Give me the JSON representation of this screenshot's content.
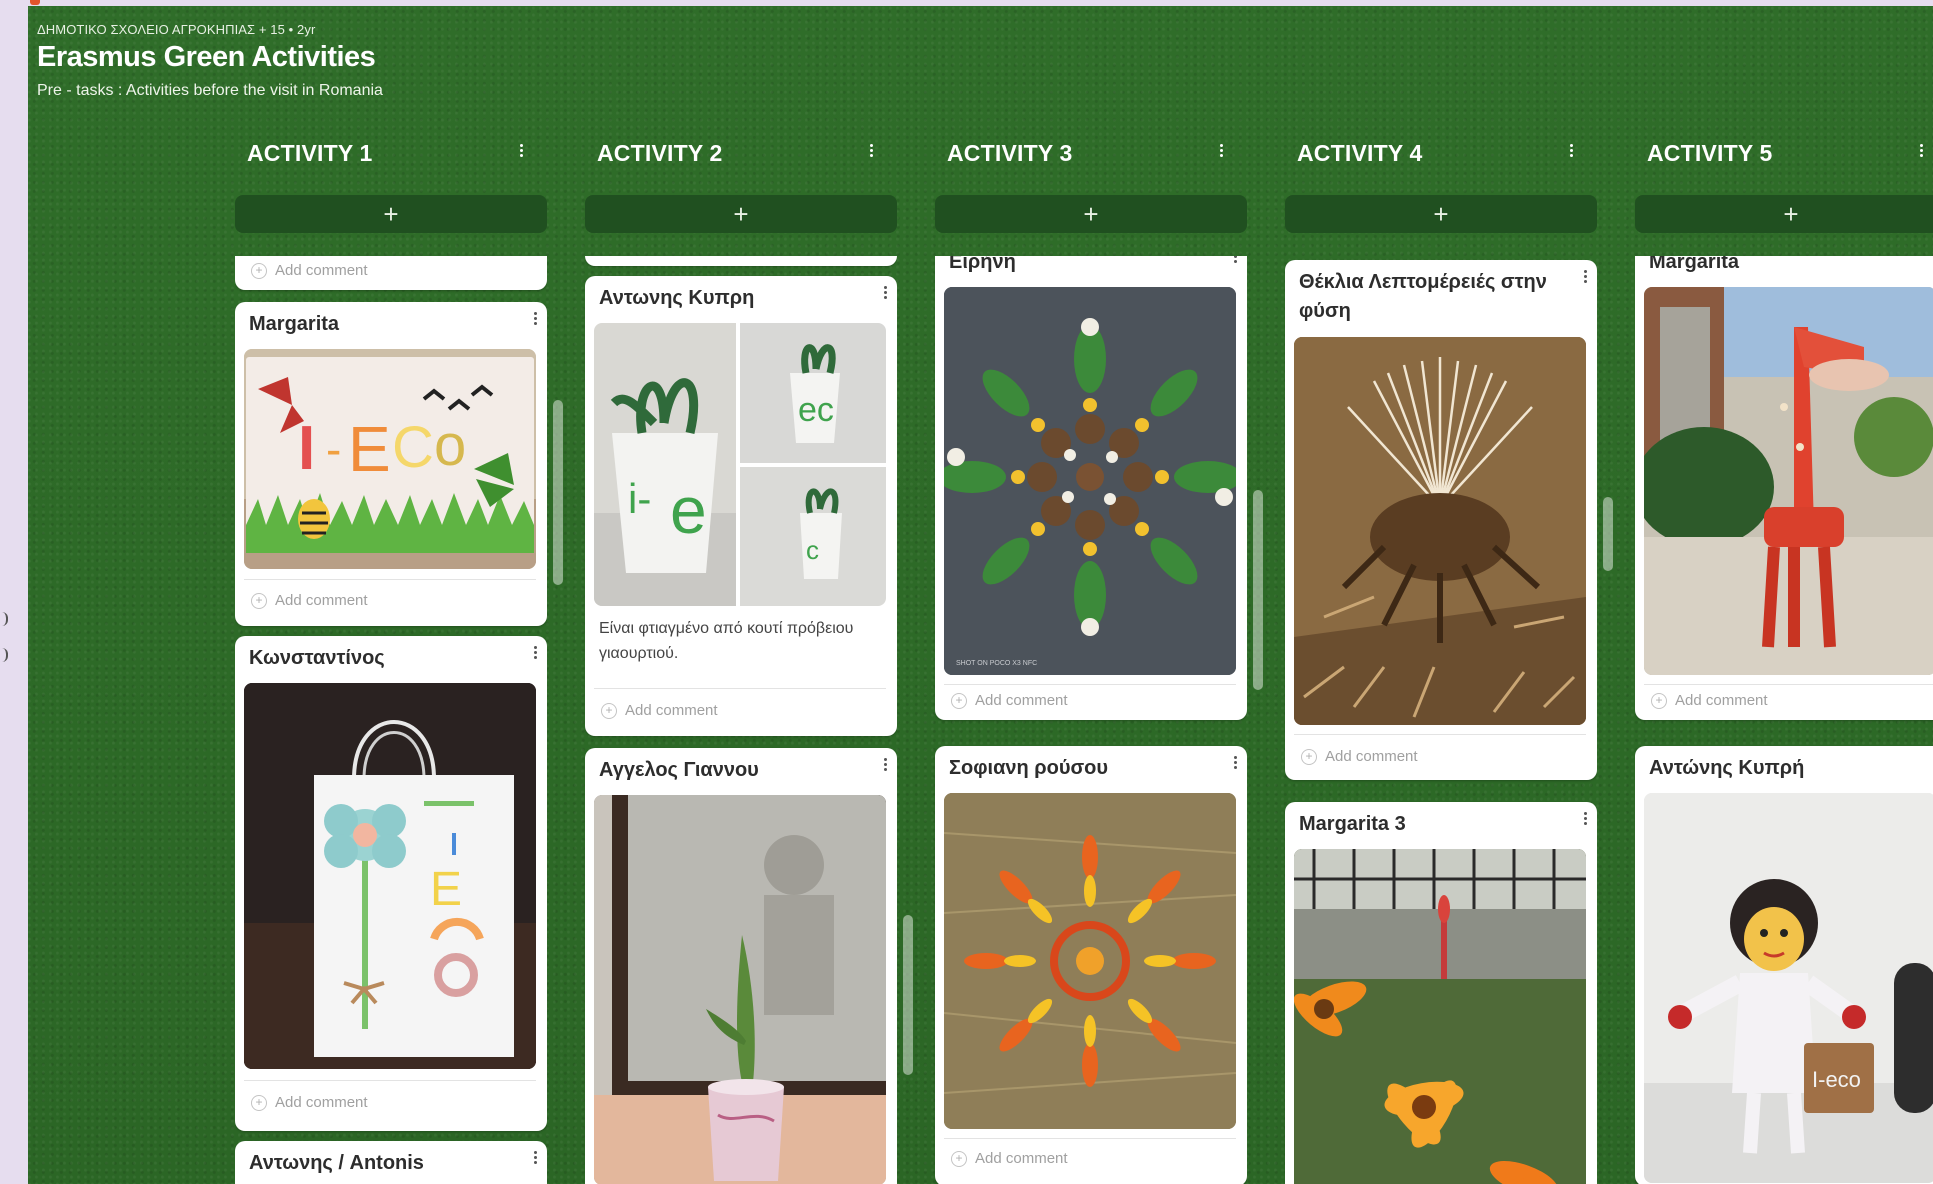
{
  "board": {
    "breadcrumb": "ΔΗΜΟΤΙΚΟ ΣΧΟΛΕΙΟ ΑΓΡΟΚΗΠΙΑΣ + 15 • 2yr",
    "title": "Erasmus Green Activities",
    "subtitle": "Pre - tasks : Activities before the visit in Romania"
  },
  "add_symbol": "+",
  "add_comment_label": "Add comment",
  "columns": [
    {
      "title": "ACTIVITY 1",
      "cards": [
        {
          "title": "Margarita",
          "image": "i-eco-paper-bag-with-butterflies"
        },
        {
          "title": "Κωνσταντίνος",
          "image": "paper-bag-with-flower"
        },
        {
          "title": "Αντωνης / Antonis"
        }
      ]
    },
    {
      "title": "ACTIVITY 2",
      "cards": [
        {
          "title": "Αντωνης Κυπρη",
          "image": "yogurt-cup-planters-collage",
          "text": "Είναι φτιαγμένο από κουτί πρόβειου γιαουρτιού."
        },
        {
          "title": "Αγγελος Γιαννου",
          "image": "aloe-in-painted-can"
        }
      ]
    },
    {
      "title": "ACTIVITY 3",
      "cards": [
        {
          "title": "Ειρήνη",
          "image": "pinecone-mandala",
          "caption": "SHOT ON POCO X3 NFC"
        },
        {
          "title": "Σοφιανη ρούσου",
          "image": "petal-mandala"
        }
      ]
    },
    {
      "title": "ACTIVITY 4",
      "cards": [
        {
          "title": "Θέκλια Λεπτομέρειές στην φύση",
          "image": "dry-thistle"
        },
        {
          "title": "Margarita 3",
          "image": "orange-gazania-flowers"
        }
      ]
    },
    {
      "title": "ACTIVITY 5",
      "cards": [
        {
          "title": "Margarita",
          "image": "recycled-giraffe-sculpture"
        },
        {
          "title": "Αντώνης Κυπρή",
          "image": "recycled-doll-figure"
        }
      ]
    }
  ]
}
